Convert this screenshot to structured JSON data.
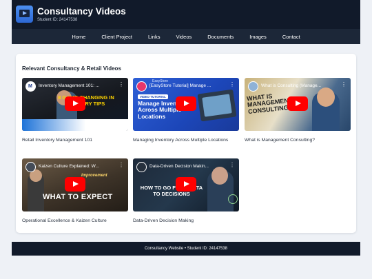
{
  "header": {
    "title": "Consultancy Videos",
    "student_id": "Student ID: 24147538",
    "logo_icon": "video-player-icon"
  },
  "nav": [
    "Home",
    "Client Project",
    "Links",
    "Videos",
    "Documents",
    "Images",
    "Contact"
  ],
  "main": {
    "section_title": "Relevant Consultancy & Retail Videos",
    "videos": [
      {
        "thumb_title": "Inventory Management 101: ...",
        "overlay": "8 GAME-CHANGING IN VENTORY TIPS",
        "caption": "Retail Inventory Management 101"
      },
      {
        "thumb_title": "[EasyStore Tutorial] Manage ...",
        "badge": "VIDEO TUTORIAL",
        "overlay": "Manage Inventory Across Multiple Locations",
        "caption": "Managing Inventory Across Multiple Locations"
      },
      {
        "thumb_title": "What is Consulting (Manage...",
        "overlay": "WHAT IS MANAGEMENT CONSULTING?",
        "caption": "What is Management Consulting?"
      },
      {
        "thumb_title": "Kaizen Culture Explained: W...",
        "overlay": "WHAT TO EXPECT",
        "overlay_small": "Improvement",
        "caption": "Operational Excellence & Kaizen Culture"
      },
      {
        "thumb_title": "Data-Driven Decision Makin...",
        "overlay": "HOW TO GO FROM DATA TO DECISIONS",
        "caption": "Data-Driven Decision Making"
      }
    ]
  },
  "footer": {
    "text": "Consultancy Website • Student ID: 24147538"
  },
  "colors": {
    "header_bg": "#111a2a",
    "nav_bg": "#1c2738",
    "page_bg": "#eef1f6",
    "play_red": "#ff0000"
  }
}
